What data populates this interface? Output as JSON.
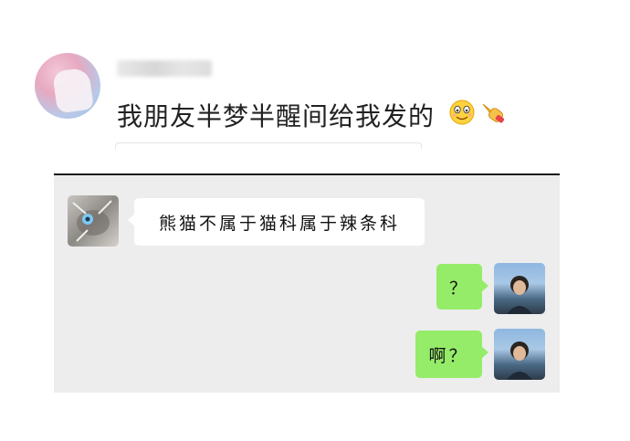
{
  "post": {
    "text": "我朋友半梦半醒间给我发的",
    "emojis": [
      "smiling-face-emoji",
      "pointing-hand-emoji"
    ]
  },
  "chat": {
    "messages": [
      {
        "side": "left",
        "text": "熊猫不属于猫科属于辣条科"
      },
      {
        "side": "right",
        "text": "？"
      },
      {
        "side": "right",
        "text": "啊？"
      }
    ]
  },
  "colors": {
    "chat_background": "#ededed",
    "incoming_bubble": "#ffffff",
    "outgoing_bubble": "#95ec69"
  }
}
